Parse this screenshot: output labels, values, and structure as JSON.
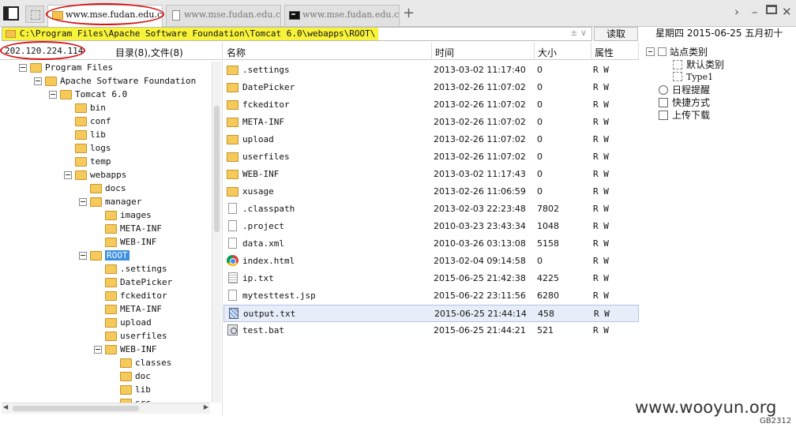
{
  "tabs": [
    {
      "label": "www.mse.fudan.edu.cn",
      "icon": "folder-icon",
      "active": true
    },
    {
      "label": "www.mse.fudan.edu.cn",
      "icon": "document-icon",
      "active": false
    },
    {
      "label": "www.mse.fudan.edu.cn",
      "icon": "terminal-icon",
      "active": false
    }
  ],
  "address_bar": {
    "path": "C:\\Program Files\\Apache Software Foundation\\Tomcat 6.0\\webapps\\ROOT\\",
    "extra": "± ∨",
    "read_button": "读取"
  },
  "datetime": "星期四 2015-06-25 五月初十",
  "left_panel": {
    "ip": "202.120.224.114",
    "counts": "目录(8),文件(8)",
    "tree": [
      {
        "label": "Program Files",
        "depth": 0,
        "expanded": true
      },
      {
        "label": "Apache Software Foundation",
        "depth": 1,
        "expanded": true
      },
      {
        "label": "Tomcat 6.0",
        "depth": 2,
        "expanded": true
      },
      {
        "label": "bin",
        "depth": 3
      },
      {
        "label": "conf",
        "depth": 3
      },
      {
        "label": "lib",
        "depth": 3
      },
      {
        "label": "logs",
        "depth": 3
      },
      {
        "label": "temp",
        "depth": 3
      },
      {
        "label": "webapps",
        "depth": 3,
        "expanded": true
      },
      {
        "label": "docs",
        "depth": 4
      },
      {
        "label": "manager",
        "depth": 4,
        "expanded": true
      },
      {
        "label": "images",
        "depth": 5
      },
      {
        "label": "META-INF",
        "depth": 5
      },
      {
        "label": "WEB-INF",
        "depth": 5
      },
      {
        "label": "ROOT",
        "depth": 4,
        "expanded": true,
        "selected": true
      },
      {
        "label": ".settings",
        "depth": 5
      },
      {
        "label": "DatePicker",
        "depth": 5
      },
      {
        "label": "fckeditor",
        "depth": 5
      },
      {
        "label": "META-INF",
        "depth": 5
      },
      {
        "label": "upload",
        "depth": 5
      },
      {
        "label": "userfiles",
        "depth": 5
      },
      {
        "label": "WEB-INF",
        "depth": 5,
        "expanded": true
      },
      {
        "label": "classes",
        "depth": 6
      },
      {
        "label": "doc",
        "depth": 6
      },
      {
        "label": "lib",
        "depth": 6
      },
      {
        "label": "src",
        "depth": 6
      }
    ]
  },
  "file_list": {
    "headers": {
      "name": "名称",
      "time": "时间",
      "size": "大小",
      "attr": "属性"
    },
    "rows": [
      {
        "name": ".settings",
        "time": "2013-03-02 11:17:40",
        "size": "0",
        "attr": "R W",
        "icon": "folder-icon"
      },
      {
        "name": "DatePicker",
        "time": "2013-02-26 11:07:02",
        "size": "0",
        "attr": "R W",
        "icon": "folder-icon"
      },
      {
        "name": "fckeditor",
        "time": "2013-02-26 11:07:02",
        "size": "0",
        "attr": "R W",
        "icon": "folder-icon"
      },
      {
        "name": "META-INF",
        "time": "2013-02-26 11:07:02",
        "size": "0",
        "attr": "R W",
        "icon": "folder-icon"
      },
      {
        "name": "upload",
        "time": "2013-02-26 11:07:02",
        "size": "0",
        "attr": "R W",
        "icon": "folder-icon"
      },
      {
        "name": "userfiles",
        "time": "2013-02-26 11:07:02",
        "size": "0",
        "attr": "R W",
        "icon": "folder-icon"
      },
      {
        "name": "WEB-INF",
        "time": "2013-03-02 11:17:43",
        "size": "0",
        "attr": "R W",
        "icon": "folder-icon"
      },
      {
        "name": "xusage",
        "time": "2013-02-26 11:06:59",
        "size": "0",
        "attr": "R W",
        "icon": "folder-icon"
      },
      {
        "name": ".classpath",
        "time": "2013-02-03 22:23:48",
        "size": "7802",
        "attr": "R W",
        "icon": "file-icon"
      },
      {
        "name": ".project",
        "time": "2010-03-23 23:43:34",
        "size": "1048",
        "attr": "R W",
        "icon": "file-icon"
      },
      {
        "name": "data.xml",
        "time": "2010-03-26 03:13:08",
        "size": "5158",
        "attr": "R W",
        "icon": "file-icon"
      },
      {
        "name": "index.html",
        "time": "2013-02-04 09:14:58",
        "size": "0",
        "attr": "R W",
        "icon": "chrome-icon"
      },
      {
        "name": "ip.txt",
        "time": "2015-06-25 21:42:38",
        "size": "4225",
        "attr": "R W",
        "icon": "text-file-icon"
      },
      {
        "name": "mytesttest.jsp",
        "time": "2015-06-22 23:11:56",
        "size": "6280",
        "attr": "R W",
        "icon": "file-icon"
      },
      {
        "name": "output.txt",
        "time": "2015-06-25 21:44:14",
        "size": "458",
        "attr": "R W",
        "icon": "text-file-selected-icon",
        "selected": true
      },
      {
        "name": "test.bat",
        "time": "2015-06-25 21:44:21",
        "size": "521",
        "attr": "R W",
        "icon": "batch-file-icon"
      }
    ]
  },
  "right_panel": {
    "items": [
      {
        "label": "站点类别",
        "kind": "category"
      },
      {
        "label": "默认类别",
        "kind": "subcategory"
      },
      {
        "label": "Type1",
        "kind": "subcategory"
      },
      {
        "label": "日程提醒",
        "kind": "action"
      },
      {
        "label": "快捷方式",
        "kind": "action"
      },
      {
        "label": "上传下载",
        "kind": "action"
      }
    ]
  },
  "watermark": "www.wooyun.org",
  "encoding": "GB2312",
  "colors": {
    "highlight": "#f7f33a",
    "annotation": "#d51515",
    "selection": "#3c8ee0"
  }
}
